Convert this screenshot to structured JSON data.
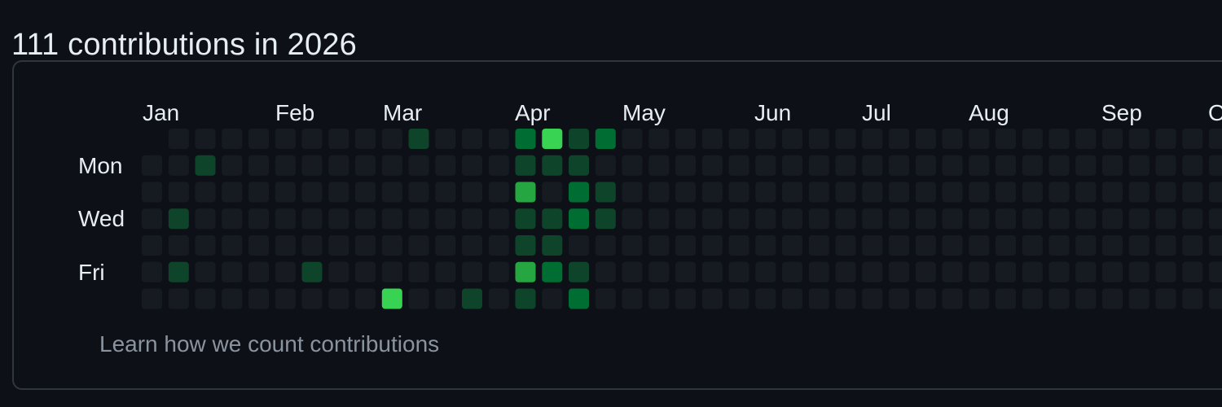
{
  "header": {
    "title": "111 contributions in 2026"
  },
  "calendar": {
    "months": [
      "Jan",
      "Feb",
      "Mar",
      "Apr",
      "May",
      "Jun",
      "Jul",
      "Aug",
      "Sep",
      "O"
    ],
    "days": [
      "Mon",
      "Wed",
      "Fri"
    ],
    "levels": [
      "#161b22",
      "#0e4429",
      "#006d32",
      "#26a641",
      "#39d353"
    ],
    "contributions": [
      {
        "week": 1,
        "day": 3,
        "level": 1
      },
      {
        "week": 1,
        "day": 5,
        "level": 1
      },
      {
        "week": 2,
        "day": 1,
        "level": 1
      },
      {
        "week": 6,
        "day": 5,
        "level": 1
      },
      {
        "week": 9,
        "day": 6,
        "level": 4
      },
      {
        "week": 10,
        "day": 0,
        "level": 1
      },
      {
        "week": 12,
        "day": 6,
        "level": 1
      },
      {
        "week": 14,
        "day": 0,
        "level": 2
      },
      {
        "week": 14,
        "day": 1,
        "level": 1
      },
      {
        "week": 14,
        "day": 2,
        "level": 3
      },
      {
        "week": 14,
        "day": 3,
        "level": 1
      },
      {
        "week": 14,
        "day": 4,
        "level": 1
      },
      {
        "week": 14,
        "day": 5,
        "level": 3
      },
      {
        "week": 14,
        "day": 6,
        "level": 1
      },
      {
        "week": 15,
        "day": 0,
        "level": 4
      },
      {
        "week": 15,
        "day": 1,
        "level": 1
      },
      {
        "week": 15,
        "day": 3,
        "level": 1
      },
      {
        "week": 15,
        "day": 4,
        "level": 1
      },
      {
        "week": 15,
        "day": 5,
        "level": 2
      },
      {
        "week": 16,
        "day": 0,
        "level": 1
      },
      {
        "week": 16,
        "day": 1,
        "level": 1
      },
      {
        "week": 16,
        "day": 2,
        "level": 2
      },
      {
        "week": 16,
        "day": 3,
        "level": 2
      },
      {
        "week": 16,
        "day": 5,
        "level": 1
      },
      {
        "week": 16,
        "day": 6,
        "level": 2
      },
      {
        "week": 17,
        "day": 0,
        "level": 2
      },
      {
        "week": 17,
        "day": 2,
        "level": 1
      },
      {
        "week": 17,
        "day": 3,
        "level": 1
      }
    ]
  },
  "footer": {
    "learn_link": "Learn how we count contributions"
  }
}
